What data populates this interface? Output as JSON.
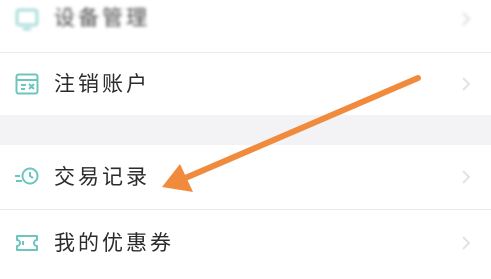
{
  "settings_list": {
    "items": [
      {
        "label": "设备管理",
        "icon": "device-icon"
      },
      {
        "label": "注销账户",
        "icon": "cancel-account-icon"
      },
      {
        "label": "交易记录",
        "icon": "transaction-record-icon"
      },
      {
        "label": "我的优惠券",
        "icon": "coupon-icon"
      }
    ]
  },
  "colors": {
    "icon_teal": "#6cc6bf",
    "annotation_arrow": "#f08a3c",
    "section_gap": "#f3f3f5"
  }
}
